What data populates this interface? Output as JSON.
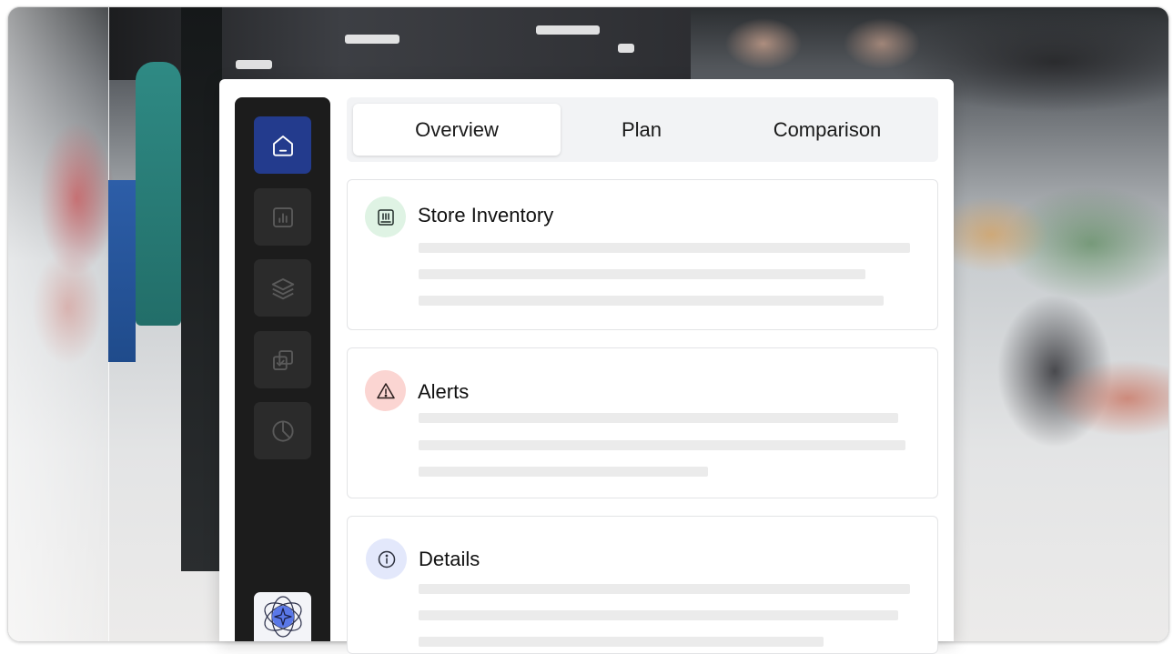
{
  "tabs": [
    {
      "label": "Overview",
      "active": true
    },
    {
      "label": "Plan",
      "active": false
    },
    {
      "label": "Comparison",
      "active": false
    }
  ],
  "sidebar": {
    "items": [
      {
        "icon": "home-icon",
        "active": true
      },
      {
        "icon": "bar-chart-icon",
        "active": false
      },
      {
        "icon": "layers-icon",
        "active": false
      },
      {
        "icon": "copy-check-icon",
        "active": false
      },
      {
        "icon": "pie-chart-icon",
        "active": false
      }
    ],
    "bottom_icon": "ai-sparkle-icon"
  },
  "cards": [
    {
      "title": "Store Inventory",
      "icon": "inventory-icon",
      "icon_bg": "#dff3e4"
    },
    {
      "title": "Alerts",
      "icon": "warning-icon",
      "icon_bg": "#fbd5d2"
    },
    {
      "title": "Details",
      "icon": "info-icon",
      "icon_bg": "#e3e8fb"
    }
  ],
  "colors": {
    "sidebar_bg": "#1c1c1c",
    "active_nav": "#233b8d",
    "tab_strip_bg": "#f2f3f5"
  }
}
